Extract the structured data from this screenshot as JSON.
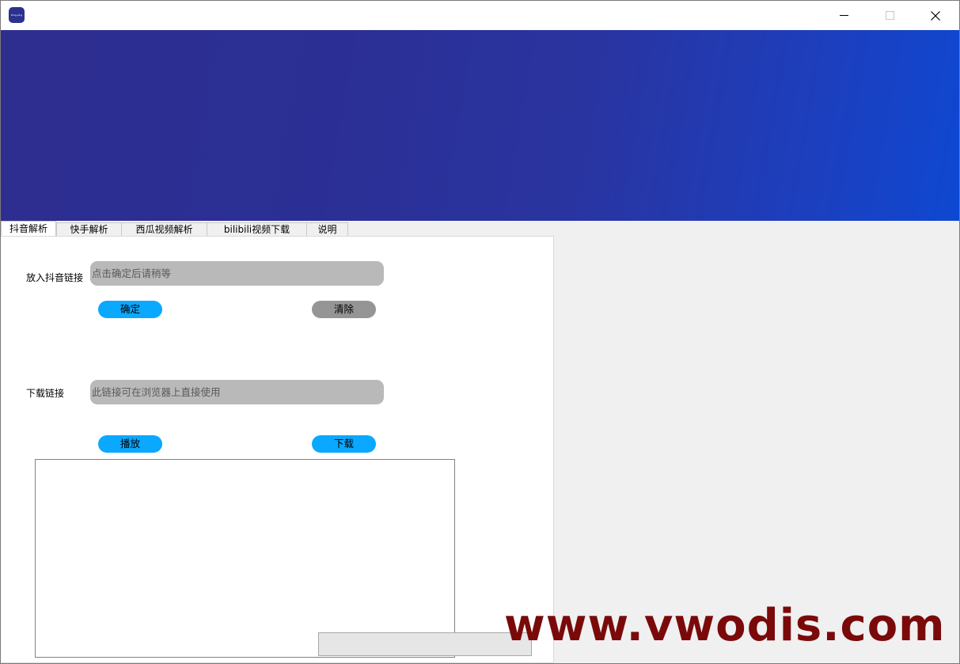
{
  "titlebar": {
    "app_icon_text": "Ding.ping",
    "buttons": {
      "minimize": "minimize-icon",
      "maximize": "maximize-icon",
      "close": "close-icon"
    }
  },
  "banner": {
    "gradient_start": "#2e2e8f",
    "gradient_end": "#0e48d2"
  },
  "tabs": [
    {
      "label": "抖音解析",
      "active": true
    },
    {
      "label": "快手解析",
      "active": false
    },
    {
      "label": "西瓜视频解析",
      "active": false
    },
    {
      "label": "bilibili视频下载",
      "active": false
    },
    {
      "label": "说明",
      "active": false
    }
  ],
  "form": {
    "input_label": "放入抖音链接",
    "input_placeholder": "点击确定后请稍等",
    "confirm_label": "确定",
    "clear_label": "清除",
    "download_label": "下载链接",
    "download_placeholder": "此链接可在浏览器上直接使用",
    "play_label": "播放",
    "download_button_label": "下载"
  },
  "colors": {
    "primary_button": "#0aa8ff",
    "secondary_button": "#959595",
    "field_bg": "#b9b9b9"
  },
  "watermark": "www.vwodis.com"
}
